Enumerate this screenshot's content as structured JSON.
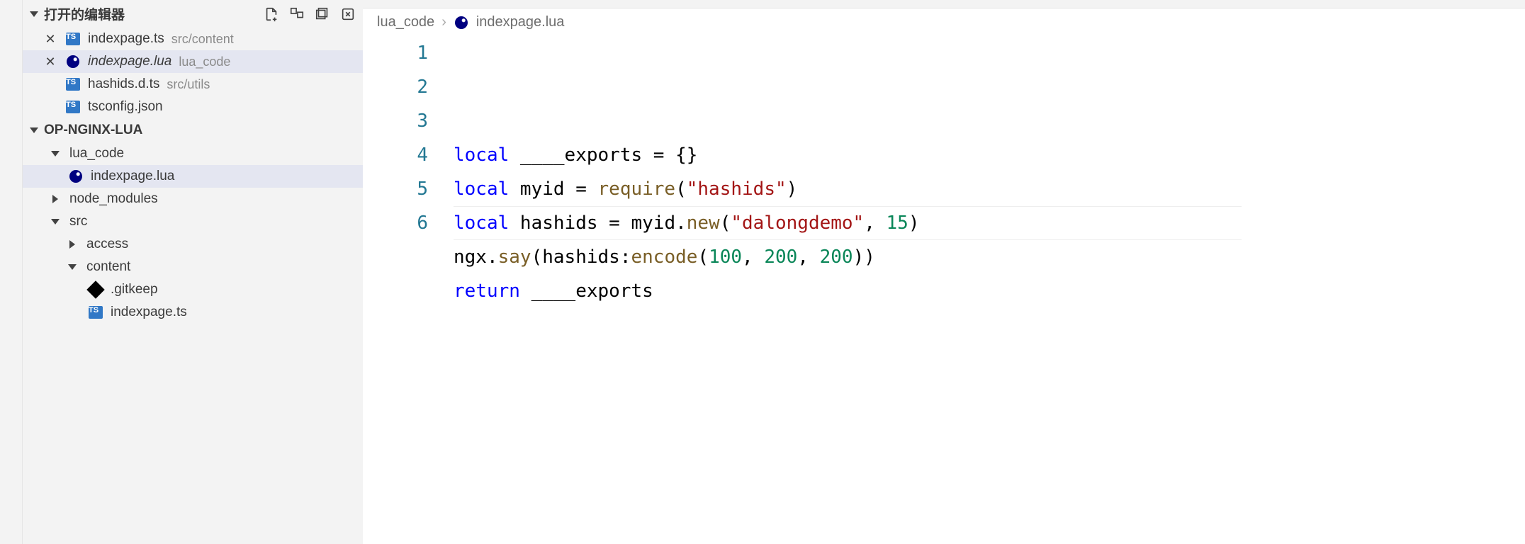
{
  "sidebar": {
    "openEditors": {
      "label": "打开的编辑器",
      "items": [
        {
          "close": true,
          "icon": "ts",
          "name": "indexpage.ts",
          "desc": "src/content",
          "italic": false,
          "active": false
        },
        {
          "close": true,
          "icon": "lua",
          "name": "indexpage.lua",
          "desc": "lua_code",
          "italic": true,
          "active": true
        },
        {
          "close": false,
          "icon": "ts",
          "name": "hashids.d.ts",
          "desc": "src/utils",
          "italic": false,
          "active": false
        },
        {
          "close": false,
          "icon": "json",
          "name": "tsconfig.json",
          "desc": "",
          "italic": false,
          "active": false
        }
      ]
    },
    "workspace": {
      "label": "OP-NGINX-LUA",
      "tree": [
        {
          "indent": 1,
          "kind": "folder",
          "open": true,
          "name": "lua_code"
        },
        {
          "indent": 2,
          "kind": "file",
          "icon": "lua",
          "name": "indexpage.lua",
          "selected": true
        },
        {
          "indent": 1,
          "kind": "folder",
          "open": false,
          "name": "node_modules"
        },
        {
          "indent": 1,
          "kind": "folder",
          "open": true,
          "name": "src"
        },
        {
          "indent": 2,
          "kind": "folder",
          "open": false,
          "name": "access"
        },
        {
          "indent": 2,
          "kind": "folder",
          "open": true,
          "name": "content"
        },
        {
          "indent": 2,
          "kind": "file-indent",
          "icon": "gitkeep",
          "name": ".gitkeep"
        },
        {
          "indent": 2,
          "kind": "file-indent",
          "icon": "ts",
          "name": "indexpage.ts"
        }
      ]
    }
  },
  "breadcrumb": {
    "segments": [
      "lua_code",
      "indexpage.lua"
    ]
  },
  "code": {
    "lines": [
      {
        "n": "1",
        "tokens": [
          {
            "t": "local",
            "c": "keyword"
          },
          {
            "t": " ____exports ",
            "c": "ident"
          },
          {
            "t": "=",
            "c": "punc"
          },
          {
            "t": " ",
            "c": "punc"
          },
          {
            "t": "{}",
            "c": "punc"
          }
        ]
      },
      {
        "n": "2",
        "tokens": [
          {
            "t": "local",
            "c": "keyword"
          },
          {
            "t": " myid ",
            "c": "ident"
          },
          {
            "t": "=",
            "c": "punc"
          },
          {
            "t": " ",
            "c": "punc"
          },
          {
            "t": "require",
            "c": "func"
          },
          {
            "t": "(",
            "c": "punc"
          },
          {
            "t": "\"hashids\"",
            "c": "string"
          },
          {
            "t": ")",
            "c": "punc"
          }
        ]
      },
      {
        "n": "3",
        "tokens": [
          {
            "t": "local",
            "c": "keyword"
          },
          {
            "t": " hashids ",
            "c": "ident"
          },
          {
            "t": "=",
            "c": "punc"
          },
          {
            "t": " myid.",
            "c": "ident"
          },
          {
            "t": "new",
            "c": "func"
          },
          {
            "t": "(",
            "c": "punc"
          },
          {
            "t": "\"dalongdemo\"",
            "c": "string"
          },
          {
            "t": ", ",
            "c": "punc"
          },
          {
            "t": "15",
            "c": "number"
          },
          {
            "t": ")",
            "c": "punc"
          }
        ]
      },
      {
        "n": "4",
        "tokens": [
          {
            "t": "ngx.",
            "c": "ident"
          },
          {
            "t": "say",
            "c": "func"
          },
          {
            "t": "(hashids:",
            "c": "punc"
          },
          {
            "t": "encode",
            "c": "func"
          },
          {
            "t": "(",
            "c": "punc"
          },
          {
            "t": "100",
            "c": "number"
          },
          {
            "t": ", ",
            "c": "punc"
          },
          {
            "t": "200",
            "c": "number"
          },
          {
            "t": ", ",
            "c": "punc"
          },
          {
            "t": "200",
            "c": "number"
          },
          {
            "t": "))",
            "c": "punc"
          }
        ]
      },
      {
        "n": "5",
        "tokens": [
          {
            "t": "return",
            "c": "keyword"
          },
          {
            "t": " ____exports",
            "c": "ident"
          }
        ]
      },
      {
        "n": "6",
        "tokens": []
      }
    ]
  }
}
